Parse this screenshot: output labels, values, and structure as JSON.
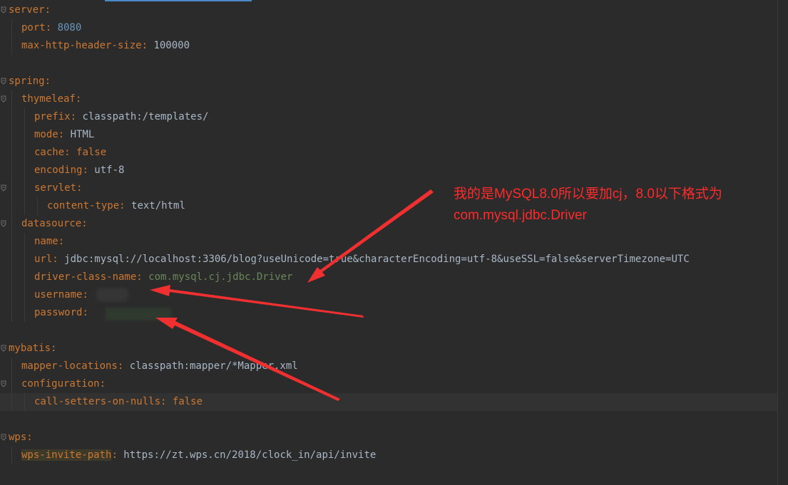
{
  "lines": [
    {
      "indent": 0,
      "key": "server",
      "sep": ":",
      "value": "",
      "value_type": "",
      "fold": true
    },
    {
      "indent": 1,
      "key": "port",
      "sep": ": ",
      "value": "8080",
      "value_type": "num",
      "fold": false
    },
    {
      "indent": 1,
      "key": "max-http-header-size",
      "sep": ": ",
      "value": "100000",
      "value_type": "val",
      "fold": false
    },
    {
      "indent": 0,
      "key": "",
      "sep": "",
      "value": "",
      "value_type": "",
      "fold": false
    },
    {
      "indent": 0,
      "key": "spring",
      "sep": ":",
      "value": "",
      "value_type": "",
      "fold": true
    },
    {
      "indent": 1,
      "key": "thymeleaf",
      "sep": ":",
      "value": "",
      "value_type": "",
      "fold": true
    },
    {
      "indent": 2,
      "key": "prefix",
      "sep": ": ",
      "value": "classpath:/templates/",
      "value_type": "val",
      "fold": false
    },
    {
      "indent": 2,
      "key": "mode",
      "sep": ": ",
      "value": "HTML",
      "value_type": "val",
      "fold": false
    },
    {
      "indent": 2,
      "key": "cache",
      "sep": ": ",
      "value": "false",
      "value_type": "bool",
      "fold": false
    },
    {
      "indent": 2,
      "key": "encoding",
      "sep": ": ",
      "value": "utf-8",
      "value_type": "val",
      "fold": false
    },
    {
      "indent": 2,
      "key": "servlet",
      "sep": ":",
      "value": "",
      "value_type": "",
      "fold": true
    },
    {
      "indent": 3,
      "key": "content-type",
      "sep": ": ",
      "value": "text/html",
      "value_type": "val",
      "fold": false
    },
    {
      "indent": 1,
      "key": "datasource",
      "sep": ":",
      "value": "",
      "value_type": "",
      "fold": true
    },
    {
      "indent": 2,
      "key": "name",
      "sep": ":",
      "value": "",
      "value_type": "",
      "fold": false
    },
    {
      "indent": 2,
      "key": "url",
      "sep": ": ",
      "value": "jdbc:mysql://localhost:3306/blog?useUnicode=true&characterEncoding=utf-8&useSSL=false&serverTimezone=UTC",
      "value_type": "val",
      "fold": false
    },
    {
      "indent": 2,
      "key": "driver-class-name",
      "sep": ": ",
      "value": "com.mysql.cj.jdbc.Driver",
      "value_type": "driver",
      "fold": false
    },
    {
      "indent": 2,
      "key": "username",
      "sep": ":",
      "value": "",
      "value_type": "",
      "fold": false
    },
    {
      "indent": 2,
      "key": "password",
      "sep": ":",
      "value": "",
      "value_type": "",
      "fold": false
    },
    {
      "indent": 0,
      "key": "",
      "sep": "",
      "value": "",
      "value_type": "",
      "fold": false
    },
    {
      "indent": 0,
      "key": "mybatis",
      "sep": ":",
      "value": "",
      "value_type": "",
      "fold": true
    },
    {
      "indent": 1,
      "key": "mapper-locations",
      "sep": ": ",
      "value": "classpath:mapper/*Mapper.xml",
      "value_type": "val",
      "fold": false
    },
    {
      "indent": 1,
      "key": "configuration",
      "sep": ":",
      "value": "",
      "value_type": "",
      "fold": true
    },
    {
      "indent": 2,
      "key": "call-setters-on-nulls",
      "sep": ": ",
      "value": "false",
      "value_type": "bool",
      "fold": false
    },
    {
      "indent": 0,
      "key": "",
      "sep": "",
      "value": "",
      "value_type": "",
      "fold": false
    },
    {
      "indent": 0,
      "key": "wps",
      "sep": ":",
      "value": "",
      "value_type": "",
      "fold": true
    },
    {
      "indent": 1,
      "key": "wps-invite-path",
      "sep": ": ",
      "value": "https://zt.wps.cn/2018/clock_in/api/invite",
      "value_type": "val",
      "fold": false,
      "highlight": true
    }
  ],
  "annotation": {
    "line1": "我的是MySQL8.0所以要加cj，8.0以下格式为",
    "line2": "com.mysql.jdbc.Driver"
  },
  "colors": {
    "background": "#2b2b2b",
    "key": "#cc7832",
    "value": "#a9b7c6",
    "number": "#6897bb",
    "driver": "#6a8759",
    "annotation": "#ff2a2a"
  }
}
